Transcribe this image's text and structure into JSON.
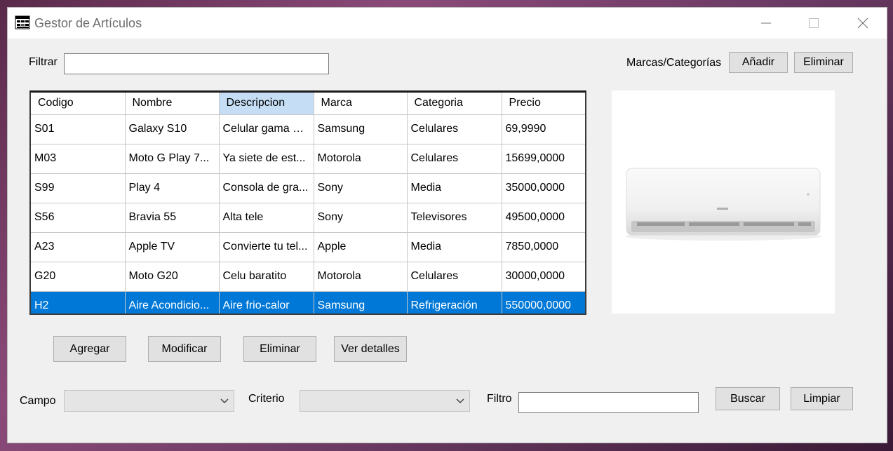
{
  "window": {
    "title": "Gestor de Artículos"
  },
  "filter": {
    "label": "Filtrar",
    "value": ""
  },
  "brands": {
    "label": "Marcas/Categorías",
    "add_label": "Añadir",
    "delete_label": "Eliminar"
  },
  "table": {
    "columns": [
      "Codigo",
      "Nombre",
      "Descripcion",
      "Marca",
      "Categoria",
      "Precio"
    ],
    "rows": [
      {
        "codigo": "S01",
        "nombre": "Galaxy S10",
        "descripcion": "Celular gama alta",
        "marca": "Samsung",
        "categoria": "Celulares",
        "precio": "69,9990"
      },
      {
        "codigo": "M03",
        "nombre": "Moto G Play 7...",
        "descripcion": "Ya siete de est...",
        "marca": "Motorola",
        "categoria": "Celulares",
        "precio": "15699,0000"
      },
      {
        "codigo": "S99",
        "nombre": "Play 4",
        "descripcion": "Consola de gra...",
        "marca": "Sony",
        "categoria": "Media",
        "precio": "35000,0000"
      },
      {
        "codigo": "S56",
        "nombre": "Bravia 55",
        "descripcion": "Alta tele",
        "marca": "Sony",
        "categoria": "Televisores",
        "precio": "49500,0000"
      },
      {
        "codigo": "A23",
        "nombre": "Apple TV",
        "descripcion": "Convierte tu tel...",
        "marca": "Apple",
        "categoria": "Media",
        "precio": "7850,0000"
      },
      {
        "codigo": "G20",
        "nombre": "Moto G20",
        "descripcion": "Celu baratito",
        "marca": "Motorola",
        "categoria": "Celulares",
        "precio": "30000,0000"
      },
      {
        "codigo": "H2",
        "nombre": "Aire Acondicio...",
        "descripcion": "Aire frio-calor",
        "marca": "Samsung",
        "categoria": "Refrigeración",
        "precio": "550000,0000"
      }
    ],
    "selected_row": 6,
    "sorted_column": 2
  },
  "actions": {
    "add_label": "Agregar",
    "modify_label": "Modificar",
    "delete_label": "Eliminar",
    "details_label": "Ver detalles"
  },
  "search": {
    "field_label": "Campo",
    "field_value": "",
    "criteria_label": "Criterio",
    "criteria_value": "",
    "filter_label": "Filtro",
    "filter_value": "",
    "search_label": "Buscar",
    "clear_label": "Limpiar"
  },
  "preview": {
    "image_icon": "air-conditioner-image"
  },
  "colors": {
    "selection": "#0078d7",
    "sorted_header": "#c5def5",
    "window_bg": "#f0f0f0"
  }
}
